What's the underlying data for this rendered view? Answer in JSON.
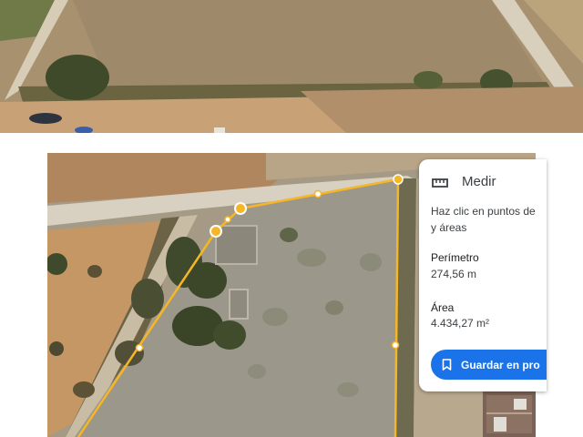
{
  "panel": {
    "title": "Medir",
    "title_icon": "ruler-icon",
    "instructions_line1": "Haz clic en puntos de",
    "instructions_line2": "y áreas",
    "perimeter_label": "Perímetro",
    "perimeter_value": "274,56 m",
    "area_label": "Área",
    "area_value": "4.434,27 m²",
    "save_button": "Guardar en pro",
    "save_icon": "bookmark-icon"
  },
  "colors": {
    "measure_line": "#f6b625",
    "button_blue": "#1a73e8",
    "dry_ground": "#b29d7c",
    "field_orange": "#c99a62"
  }
}
